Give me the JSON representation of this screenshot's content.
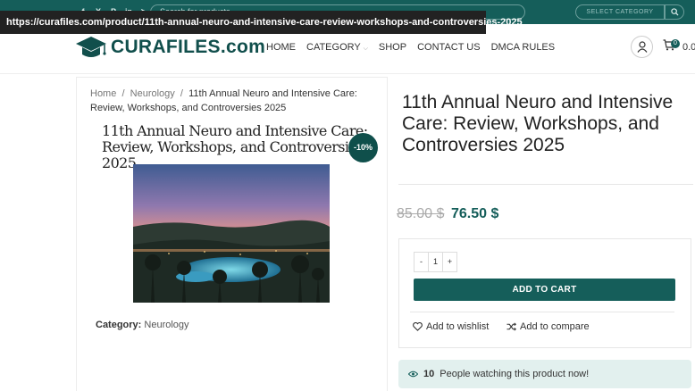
{
  "topbar": {
    "social_icons": [
      "facebook-icon",
      "x-icon",
      "pinterest-icon",
      "linkedin-icon",
      "telegram-icon"
    ],
    "social_glyphs": [
      "f",
      "X",
      "P",
      "in",
      "➤"
    ],
    "search_placeholder": "Search for products",
    "category_select": "SELECT CATEGORY"
  },
  "url_tooltip": "https://curafiles.com/product/11th-annual-neuro-and-intensive-care-review-workshops-and-controversies-2025",
  "header": {
    "logo": "CURAFILES.com",
    "nav": [
      "HOME",
      "CATEGORY",
      "SHOP",
      "CONTACT US",
      "DMCA RULES"
    ],
    "cart_count": "0",
    "cart_total": "0.0"
  },
  "breadcrumb": {
    "home": "Home",
    "sep": "/",
    "category": "Neurology",
    "current": "11th Annual Neuro and Intensive Care: Review, Workshops, and Controversies 2025"
  },
  "product": {
    "image_title": "11th Annual Neuro and Intensive Care: Review, Workshops, and Controversies 2025",
    "discount_badge": "-10%",
    "title": "11th Annual Neuro and Intensive Care: Review, Workshops, and Controversies 2025",
    "old_price": "85.00 $",
    "new_price": "76.50 $",
    "category_label": "Category:",
    "category_value": "Neurology"
  },
  "cart": {
    "qty_minus": "-",
    "qty_value": "1",
    "qty_plus": "+",
    "add_to_cart": "ADD TO CART",
    "wishlist": "Add to wishlist",
    "compare": "Add to compare"
  },
  "watching": {
    "count": "10",
    "text": "People watching this product now!"
  },
  "colors": {
    "brand": "#155e5a",
    "badge": "#0f4f4b",
    "watching_bg": "#e2f0ee"
  }
}
